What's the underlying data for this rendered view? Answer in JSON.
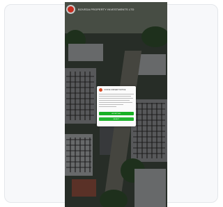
{
  "app": {
    "header_title": "BOVEDA PROPERTY INVESTMENTS LTD"
  },
  "dialog": {
    "title": "COOKIE CONSENT NOTICE",
    "accept_label": "ACCEPT ALL",
    "reject_label": "REJECT"
  },
  "colors": {
    "accent_green": "#18b124",
    "logo_red": "#c62d1f"
  }
}
